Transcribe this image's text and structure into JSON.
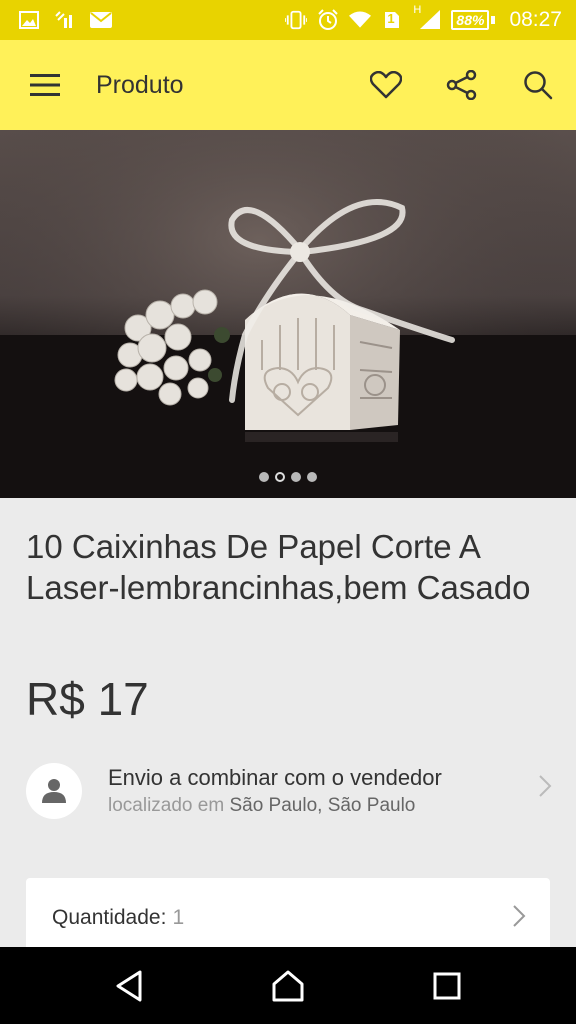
{
  "status_bar": {
    "battery": "88%",
    "time": "08:27",
    "network_tag": "H",
    "sim_slot": "1"
  },
  "app_bar": {
    "title": "Produto",
    "icons": [
      "menu-icon",
      "heart-icon",
      "share-icon",
      "search-icon"
    ],
    "background": "#fff159"
  },
  "gallery": {
    "image_count": 4,
    "active_index": 1
  },
  "product": {
    "title": "10 Caixinhas De Papel Corte A Laser-lembrancinhas,bem Casado",
    "price": "R$ 17"
  },
  "shipping": {
    "title": "Envio a combinar com o vendedor",
    "location_label": "localizado em",
    "location": "São Paulo, São Paulo"
  },
  "quantity": {
    "label": "Quantidade:",
    "value": "1"
  },
  "nav_bar": {
    "icons": [
      "back-icon",
      "home-icon",
      "recents-icon"
    ]
  }
}
